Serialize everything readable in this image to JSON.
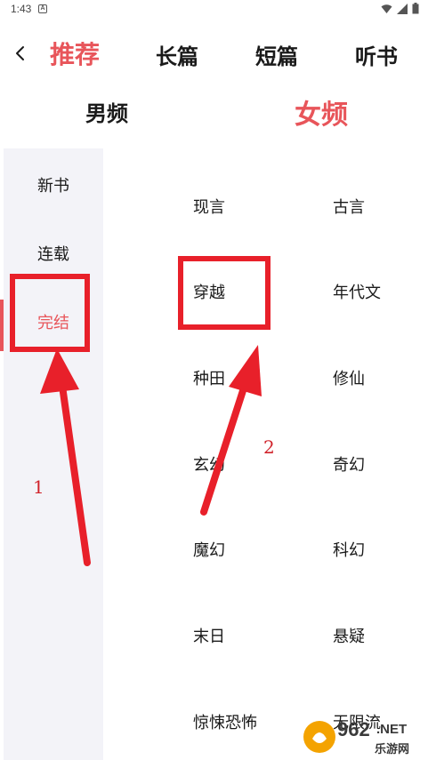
{
  "status": {
    "time": "1:43",
    "badge": "A"
  },
  "top_tabs": [
    {
      "label": "推荐",
      "active": true
    },
    {
      "label": "长篇",
      "active": false
    },
    {
      "label": "短篇",
      "active": false
    },
    {
      "label": "听书",
      "active": false
    }
  ],
  "gender_tabs": [
    {
      "label": "男频",
      "active": false
    },
    {
      "label": "女频",
      "active": true
    }
  ],
  "sidebar": {
    "items": [
      {
        "label": "新书"
      },
      {
        "label": "连载"
      },
      {
        "label": "完结",
        "active": true
      }
    ]
  },
  "genres": [
    "现言",
    "古言",
    "穿越",
    "年代文",
    "种田",
    "修仙",
    "玄幻",
    "奇幻",
    "魔幻",
    "科幻",
    "末日",
    "悬疑",
    "惊悚恐怖",
    "无限流"
  ],
  "annotations": {
    "step1": "1",
    "step2": "2"
  },
  "watermark": {
    "logo_text": "962",
    "suffix": ".NET",
    "sub": "乐游网"
  },
  "colors": {
    "accent": "#e8555a",
    "annotation": "#e8202a",
    "sidebar_bg": "#f3f3f8"
  },
  "icons": [
    "back-chevron-icon",
    "wifi-icon",
    "cellular-signal-icon",
    "battery-icon"
  ]
}
